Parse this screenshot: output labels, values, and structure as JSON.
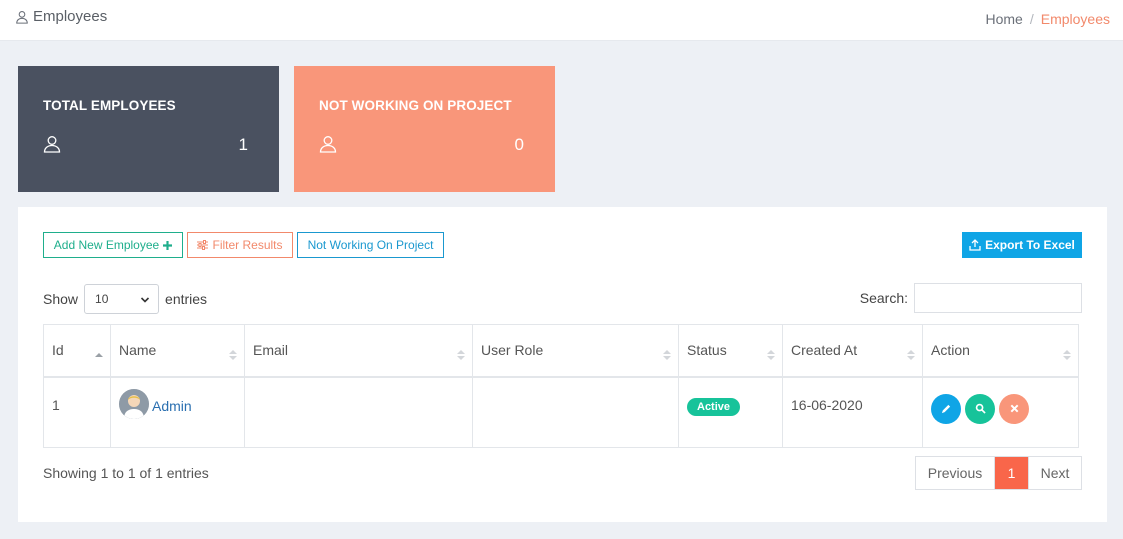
{
  "header": {
    "title": "Employees",
    "breadcrumb": {
      "home": "Home",
      "separator": "/",
      "current": "Employees"
    }
  },
  "stats": [
    {
      "label": "TOTAL EMPLOYEES",
      "value": "1",
      "icon": "user-icon",
      "color": "#4a5160"
    },
    {
      "label": "NOT WORKING ON PROJECT",
      "value": "0",
      "icon": "user-icon",
      "color": "#f9967a"
    }
  ],
  "toolbar": {
    "add_label": "Add New Employee",
    "filter_label": "Filter Results",
    "not_working_label": "Not Working On Project",
    "export_label": "Export To Excel"
  },
  "table_controls": {
    "show_label": "Show",
    "page_size": "10",
    "entries_label": "entries",
    "search_label": "Search:",
    "search_value": ""
  },
  "table": {
    "columns": [
      "Id",
      "Name",
      "Email",
      "User Role",
      "Status",
      "Created At",
      "Action"
    ],
    "rows": [
      {
        "id": "1",
        "name": "Admin",
        "email": "",
        "role": "",
        "status": "Active",
        "created": "16-06-2020"
      }
    ]
  },
  "footer": {
    "info": "Showing 1 to 1 of 1 entries",
    "prev": "Previous",
    "page": "1",
    "next": "Next"
  },
  "colors": {
    "accent_orange": "#f9967a",
    "accent_green": "#17c39a",
    "accent_blue": "#0fa5e6",
    "dark": "#4a5160"
  }
}
